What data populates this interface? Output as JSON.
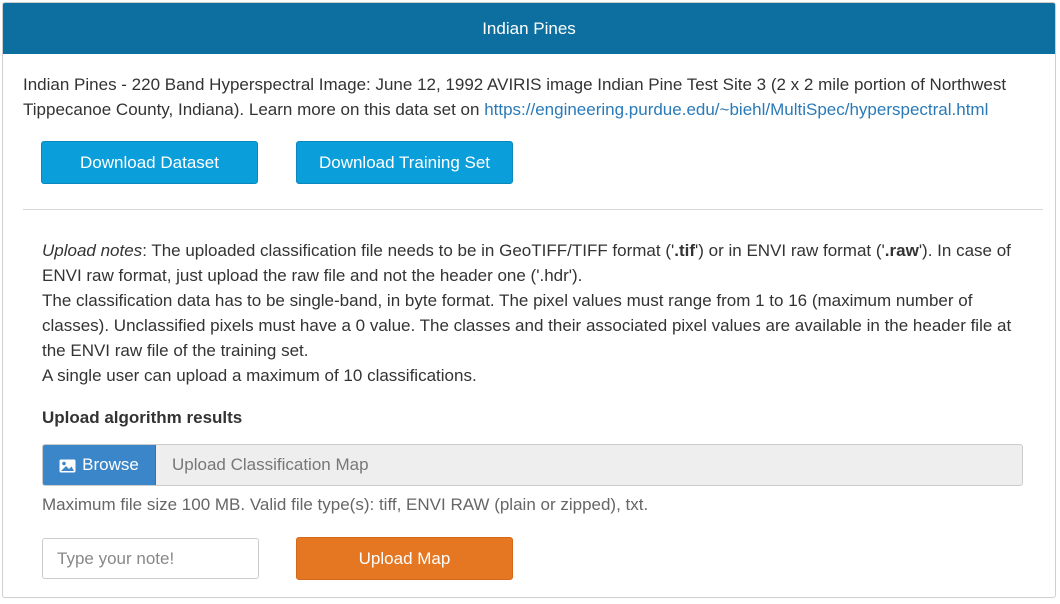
{
  "panel": {
    "title": "Indian Pines",
    "description_prefix": "Indian Pines - 220 Band Hyperspectral Image: June 12, 1992 AVIRIS image Indian Pine Test Site 3 (2 x 2 mile portion of Northwest Tippecanoe County, Indiana). Learn more on this data set on ",
    "description_link": "https://engineering.purdue.edu/~biehl/MultiSpec/hyperspectral.html"
  },
  "buttons": {
    "download_dataset": "Download Dataset",
    "download_training": "Download Training Set",
    "upload_map": "Upload Map"
  },
  "notes": {
    "label": "Upload notes",
    "line1_a": ": The uploaded classification file needs to be in GeoTIFF/TIFF format ('",
    "tif": ".tif",
    "line1_b": "') or in ENVI raw format ('",
    "raw": ".raw",
    "line1_c": "'). In case of ENVI raw format, just upload the raw file and not the header one ('.hdr').",
    "line2": "The classification data has to be single-band, in byte format. The pixel values must range from 1 to 16 (maximum number of classes). Unclassified pixels must have a 0 value. The classes and their associated pixel values are available in the header file at the ENVI raw file of the training set.",
    "line3": "A single user can upload a maximum of 10 classifications."
  },
  "upload": {
    "title": "Upload algorithm results",
    "browse_label": "Browse",
    "file_placeholder": "Upload Classification Map",
    "hint": "Maximum file size 100 MB. Valid file type(s): tiff, ENVI RAW (plain or zipped), txt.",
    "note_placeholder": "Type your note!"
  },
  "colors": {
    "header": "#0c6fa0",
    "primary_button": "#0a9edb",
    "upload_button": "#e67722",
    "browse_button": "#3a86c8",
    "link": "#2a7ab8"
  },
  "icons": {
    "browse": "image-icon"
  }
}
